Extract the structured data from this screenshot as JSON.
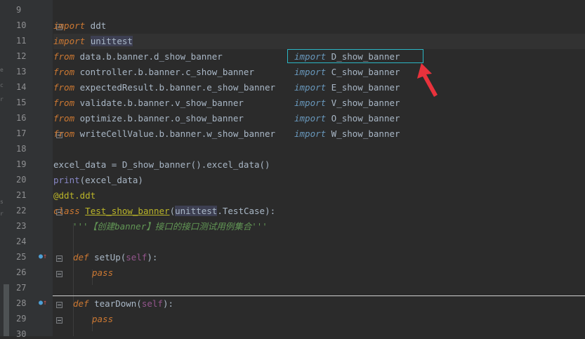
{
  "gutter": {
    "line_numbers": [
      "9",
      "10",
      "11",
      "12",
      "13",
      "14",
      "15",
      "16",
      "17",
      "18",
      "19",
      "20",
      "21",
      "22",
      "23",
      "24",
      "25",
      "26",
      "27",
      "28",
      "29",
      "30"
    ]
  },
  "code": {
    "l10": [
      "import",
      " ddt"
    ],
    "l11": [
      "import",
      " ",
      "unittest"
    ],
    "l12": [
      "from",
      " data.b.banner.d_show_banner"
    ],
    "l13": [
      "from",
      " controller.b.banner.c_show_banner"
    ],
    "l14": [
      "from",
      " expectedResult.b.banner.e_show_banner"
    ],
    "l15": [
      "from",
      " validate.b.banner.v_show_banner"
    ],
    "l16": [
      "from",
      " optimize.b.banner.o_show_banner"
    ],
    "l17": [
      "from",
      " writeCellValue.b.banner.w_show_banner"
    ],
    "l19": "excel_data = D_show_banner().excel_data()",
    "l20": [
      "print",
      "(excel_data)"
    ],
    "l21": "@ddt.ddt",
    "l22": [
      "class",
      " ",
      "Test_show_banner",
      "(",
      "unittest",
      ".TestCase):"
    ],
    "l23": "'''【创建banner】接口的接口测试用例集合'''",
    "l25": [
      "def",
      " setUp(",
      "self",
      "):"
    ],
    "l26": "pass",
    "l28": [
      "def",
      " tearDown(",
      "self",
      "):"
    ],
    "l29": "pass"
  },
  "imports": [
    {
      "kw": "import",
      "name": " D_show_banner"
    },
    {
      "kw": "import",
      "name": " C_show_banner"
    },
    {
      "kw": "import",
      "name": " E_show_banner"
    },
    {
      "kw": "import",
      "name": " V_show_banner"
    },
    {
      "kw": "import",
      "name": " O_show_banner"
    },
    {
      "kw": "import",
      "name": " W_show_banner"
    }
  ],
  "left_strip_glyphs": [
    "e",
    "c",
    "r",
    "s",
    "r"
  ],
  "colors": {
    "highlight_box": "#2bb6c4",
    "arrow": "#e8323c",
    "keyword": "#cc7832",
    "docstring": "#629755"
  },
  "icons": {
    "override": "override-icon",
    "fold": "fold-icon",
    "arrow": "red-arrow-annotation"
  }
}
